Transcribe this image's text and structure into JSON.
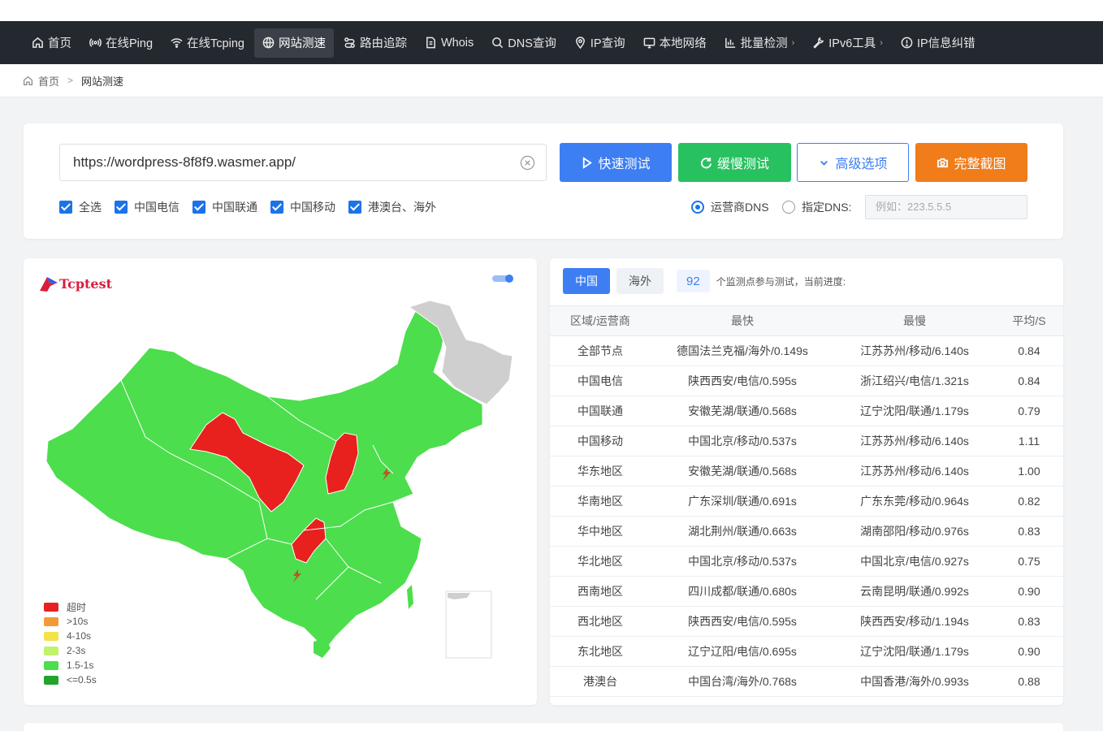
{
  "nav": {
    "items": [
      {
        "label": "首页",
        "icon": "home-icon"
      },
      {
        "label": "在线Ping",
        "icon": "signal-icon"
      },
      {
        "label": "在线Tcping",
        "icon": "wifi-icon"
      },
      {
        "label": "网站测速",
        "icon": "globe-icon",
        "active": true
      },
      {
        "label": "路由追踪",
        "icon": "route-icon"
      },
      {
        "label": "Whois",
        "icon": "document-icon"
      },
      {
        "label": "DNS查询",
        "icon": "search-icon"
      },
      {
        "label": "IP查询",
        "icon": "location-icon"
      },
      {
        "label": "本地网络",
        "icon": "monitor-icon"
      },
      {
        "label": "批量检测",
        "icon": "bar-chart-icon",
        "dropdown": true
      },
      {
        "label": "IPv6工具",
        "icon": "wrench-icon",
        "dropdown": true
      },
      {
        "label": "IP信息纠错",
        "icon": "alert-icon"
      }
    ]
  },
  "breadcrumb": {
    "home": "首页",
    "sep": ">",
    "current": "网站测速"
  },
  "search": {
    "url": "https://wordpress-8f8f9.wasmer.app/",
    "buttons": {
      "fast": "快速测试",
      "slow": "缓慢测试",
      "advanced": "高级选项",
      "screenshot": "完整截图"
    },
    "checks": [
      "全选",
      "中国电信",
      "中国联通",
      "中国移动",
      "港澳台、海外"
    ],
    "dns_isp": "运营商DNS",
    "dns_custom": "指定DNS:",
    "dns_placeholder": "例如：223.5.5.5"
  },
  "map": {
    "logo": "Tcptest",
    "legend": [
      {
        "label": "超时",
        "color": "#e8201e"
      },
      {
        "label": ">10s",
        "color": "#f29a38"
      },
      {
        "label": "4-10s",
        "color": "#f3e34a"
      },
      {
        "label": "2-3s",
        "color": "#c2f26a"
      },
      {
        "label": "1.5-1s",
        "color": "#4cde4c"
      },
      {
        "label": "<=0.5s",
        "color": "#22a32a"
      }
    ]
  },
  "results": {
    "tabs": [
      "中国",
      "海外"
    ],
    "count": "92",
    "progress_text": "个监测点参与测试，当前进度:",
    "headers": [
      "区域/运营商",
      "最快",
      "最慢",
      "平均/S"
    ],
    "rows": [
      [
        "全部节点",
        "德国法兰克福/海外/0.149s",
        "江苏苏州/移动/6.140s",
        "0.84"
      ],
      [
        "中国电信",
        "陕西西安/电信/0.595s",
        "浙江绍兴/电信/1.321s",
        "0.84"
      ],
      [
        "中国联通",
        "安徽芜湖/联通/0.568s",
        "辽宁沈阳/联通/1.179s",
        "0.79"
      ],
      [
        "中国移动",
        "中国北京/移动/0.537s",
        "江苏苏州/移动/6.140s",
        "1.11"
      ],
      [
        "华东地区",
        "安徽芜湖/联通/0.568s",
        "江苏苏州/移动/6.140s",
        "1.00"
      ],
      [
        "华南地区",
        "广东深圳/联通/0.691s",
        "广东东莞/移动/0.964s",
        "0.82"
      ],
      [
        "华中地区",
        "湖北荆州/联通/0.663s",
        "湖南邵阳/移动/0.976s",
        "0.83"
      ],
      [
        "华北地区",
        "中国北京/移动/0.537s",
        "中国北京/电信/0.927s",
        "0.75"
      ],
      [
        "西南地区",
        "四川成都/联通/0.680s",
        "云南昆明/联通/0.992s",
        "0.90"
      ],
      [
        "西北地区",
        "陕西西安/电信/0.595s",
        "陕西西安/移动/1.194s",
        "0.83"
      ],
      [
        "东北地区",
        "辽宁辽阳/电信/0.695s",
        "辽宁沈阳/联通/1.179s",
        "0.90"
      ],
      [
        "港澳台",
        "中国台湾/海外/0.768s",
        "中国香港/海外/0.993s",
        "0.88"
      ]
    ]
  }
}
